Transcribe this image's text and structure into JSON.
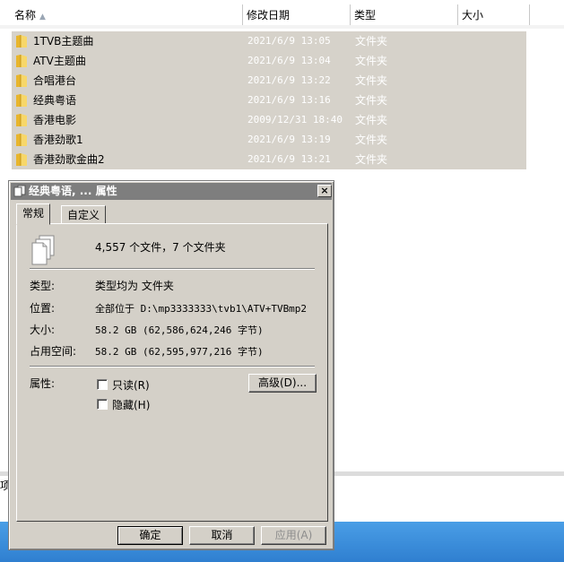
{
  "explorer": {
    "columns": [
      "名称",
      "修改日期",
      "类型",
      "大小"
    ],
    "files": [
      {
        "name": "1TVB主题曲",
        "date": "2021/6/9 13:05",
        "type": "文件夹"
      },
      {
        "name": "ATV主题曲",
        "date": "2021/6/9 13:04",
        "type": "文件夹"
      },
      {
        "name": "合唱港台",
        "date": "2021/6/9 13:22",
        "type": "文件夹"
      },
      {
        "name": "经典粤语",
        "date": "2021/6/9 13:16",
        "type": "文件夹"
      },
      {
        "name": "香港电影",
        "date": "2009/12/31 18:40",
        "type": "文件夹"
      },
      {
        "name": "香港劲歌1",
        "date": "2021/6/9 13:19",
        "type": "文件夹"
      },
      {
        "name": "香港劲歌金曲2",
        "date": "2021/6/9 13:21",
        "type": "文件夹"
      }
    ],
    "status_fragment": "项"
  },
  "dialog": {
    "title": "经典粤语, ... 属性",
    "close_label": "×",
    "tabs": [
      "常规",
      "自定义"
    ],
    "summary": "4,557 个文件，7 个文件夹",
    "type_label": "类型:",
    "type_value": "类型均为 文件夹",
    "location_label": "位置:",
    "location_value": "全部位于 D:\\mp3333333\\tvb1\\ATV+TVBmp2",
    "size_label": "大小:",
    "size_value": "58.2 GB (62,586,624,246 字节)",
    "size_on_disk_label": "占用空间:",
    "size_on_disk_value": "58.2 GB (62,595,977,216 字节)",
    "attributes_label": "属性:",
    "readonly_label": "只读(R)",
    "hidden_label": "隐藏(H)",
    "advanced_button": "高级(D)...",
    "ok_button": "确定",
    "cancel_button": "取消",
    "apply_button": "应用(A)"
  },
  "colors": {
    "selection": "#d6d2ca",
    "dialog_face": "#d4d0c8",
    "titlebar_inactive": "#7e7e7e",
    "taskbar": "#3a8ede"
  }
}
